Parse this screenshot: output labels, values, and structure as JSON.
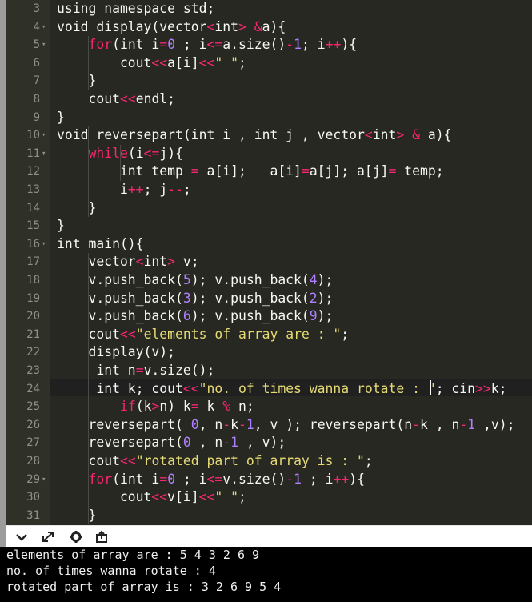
{
  "editor": {
    "line_numbers": [
      "3",
      "4",
      "5",
      "6",
      "7",
      "8",
      "9",
      "10",
      "11",
      "12",
      "13",
      "14",
      "15",
      "16",
      "17",
      "18",
      "19",
      "20",
      "21",
      "22",
      "23",
      "24",
      "25",
      "26",
      "27",
      "28",
      "29",
      "30",
      "31"
    ],
    "lines": [
      "using namespace std;",
      "void display(vector<int> &a){",
      "    for(int i=0 ; i<=a.size()-1; i++){",
      "        cout<<a[i]<<\" \";",
      "    }",
      "    cout<<endl;",
      "}",
      "void reversepart(int i , int j , vector<int> & a){",
      "    while(i<=j){",
      "        int temp = a[i];   a[i]=a[j]; a[j]= temp;",
      "        i++; j--;",
      "    }",
      "}",
      "int main(){",
      "    vector<int> v;",
      "    v.push_back(5); v.push_back(4);",
      "    v.push_back(3); v.push_back(2);",
      "    v.push_back(6); v.push_back(9);",
      "    cout<<\"elements of array are : \";",
      "    display(v);",
      "     int n=v.size();",
      "     int k; cout<<\"no. of times wanna rotate : \"; cin>>k;",
      "        if(k>n) k= k % n;",
      "    reversepart( 0, n-k-1, v ); reversepart(n-k , n-1 ,v);",
      "    reversepart(0 , n-1 , v);",
      "    cout<<\"rotated part of array is : \";",
      "    for(int i=0 ; i<=v.size()-1 ; i++){",
      "        cout<<v[i]<<\" \";",
      "    }"
    ],
    "fold_markers": [
      "4",
      "5",
      "10",
      "11",
      "16",
      "29"
    ]
  },
  "toolbar": {
    "icons": [
      "chevron-down-icon",
      "expand-icon",
      "gear-icon",
      "share-icon"
    ]
  },
  "console": {
    "lines": [
      "elements of array are : 5 4 3 2 6 9",
      "no. of times wanna rotate : 4",
      "rotated part of array is : 3 2 6 9 5 4"
    ]
  },
  "colors": {
    "editor_bg": "#272822",
    "gutter_bg": "#2f3129",
    "keyword": "#f92672",
    "number": "#ae81ff",
    "string": "#e6db74",
    "text": "#f8f8f2",
    "console_bg": "#000000"
  }
}
